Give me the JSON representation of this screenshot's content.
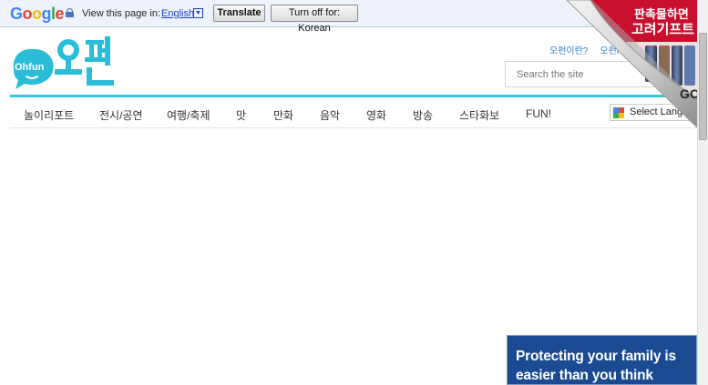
{
  "translate_bar": {
    "brand": "Google",
    "view_label": "View this page in:",
    "language": "English",
    "translate_button": "Translate",
    "turn_off_button": "Turn off for: Korean"
  },
  "site": {
    "logo_text_en": "Ohfun",
    "logo_text_ko": "오펀",
    "top_links": [
      "오펀이란?",
      "오펀RS"
    ],
    "search_placeholder": "Search the site"
  },
  "nav": {
    "items": [
      "놀이리포트",
      "전시/공연",
      "여행/축제",
      "맛",
      "만화",
      "음악",
      "영화",
      "방송",
      "스타화보",
      "FUN!"
    ],
    "language_select": "Select Language"
  },
  "corner_ad": {
    "line1": "판촉물하면",
    "line2": "고려기프트",
    "cta": "GO"
  },
  "bottom_ad": {
    "line1": "Protecting your family is",
    "line2": "easier than you think"
  },
  "colors": {
    "accent": "#32c7d9",
    "link": "#2c79c9",
    "ad_blue": "#1a4b92",
    "ad_red": "#c8102e"
  }
}
